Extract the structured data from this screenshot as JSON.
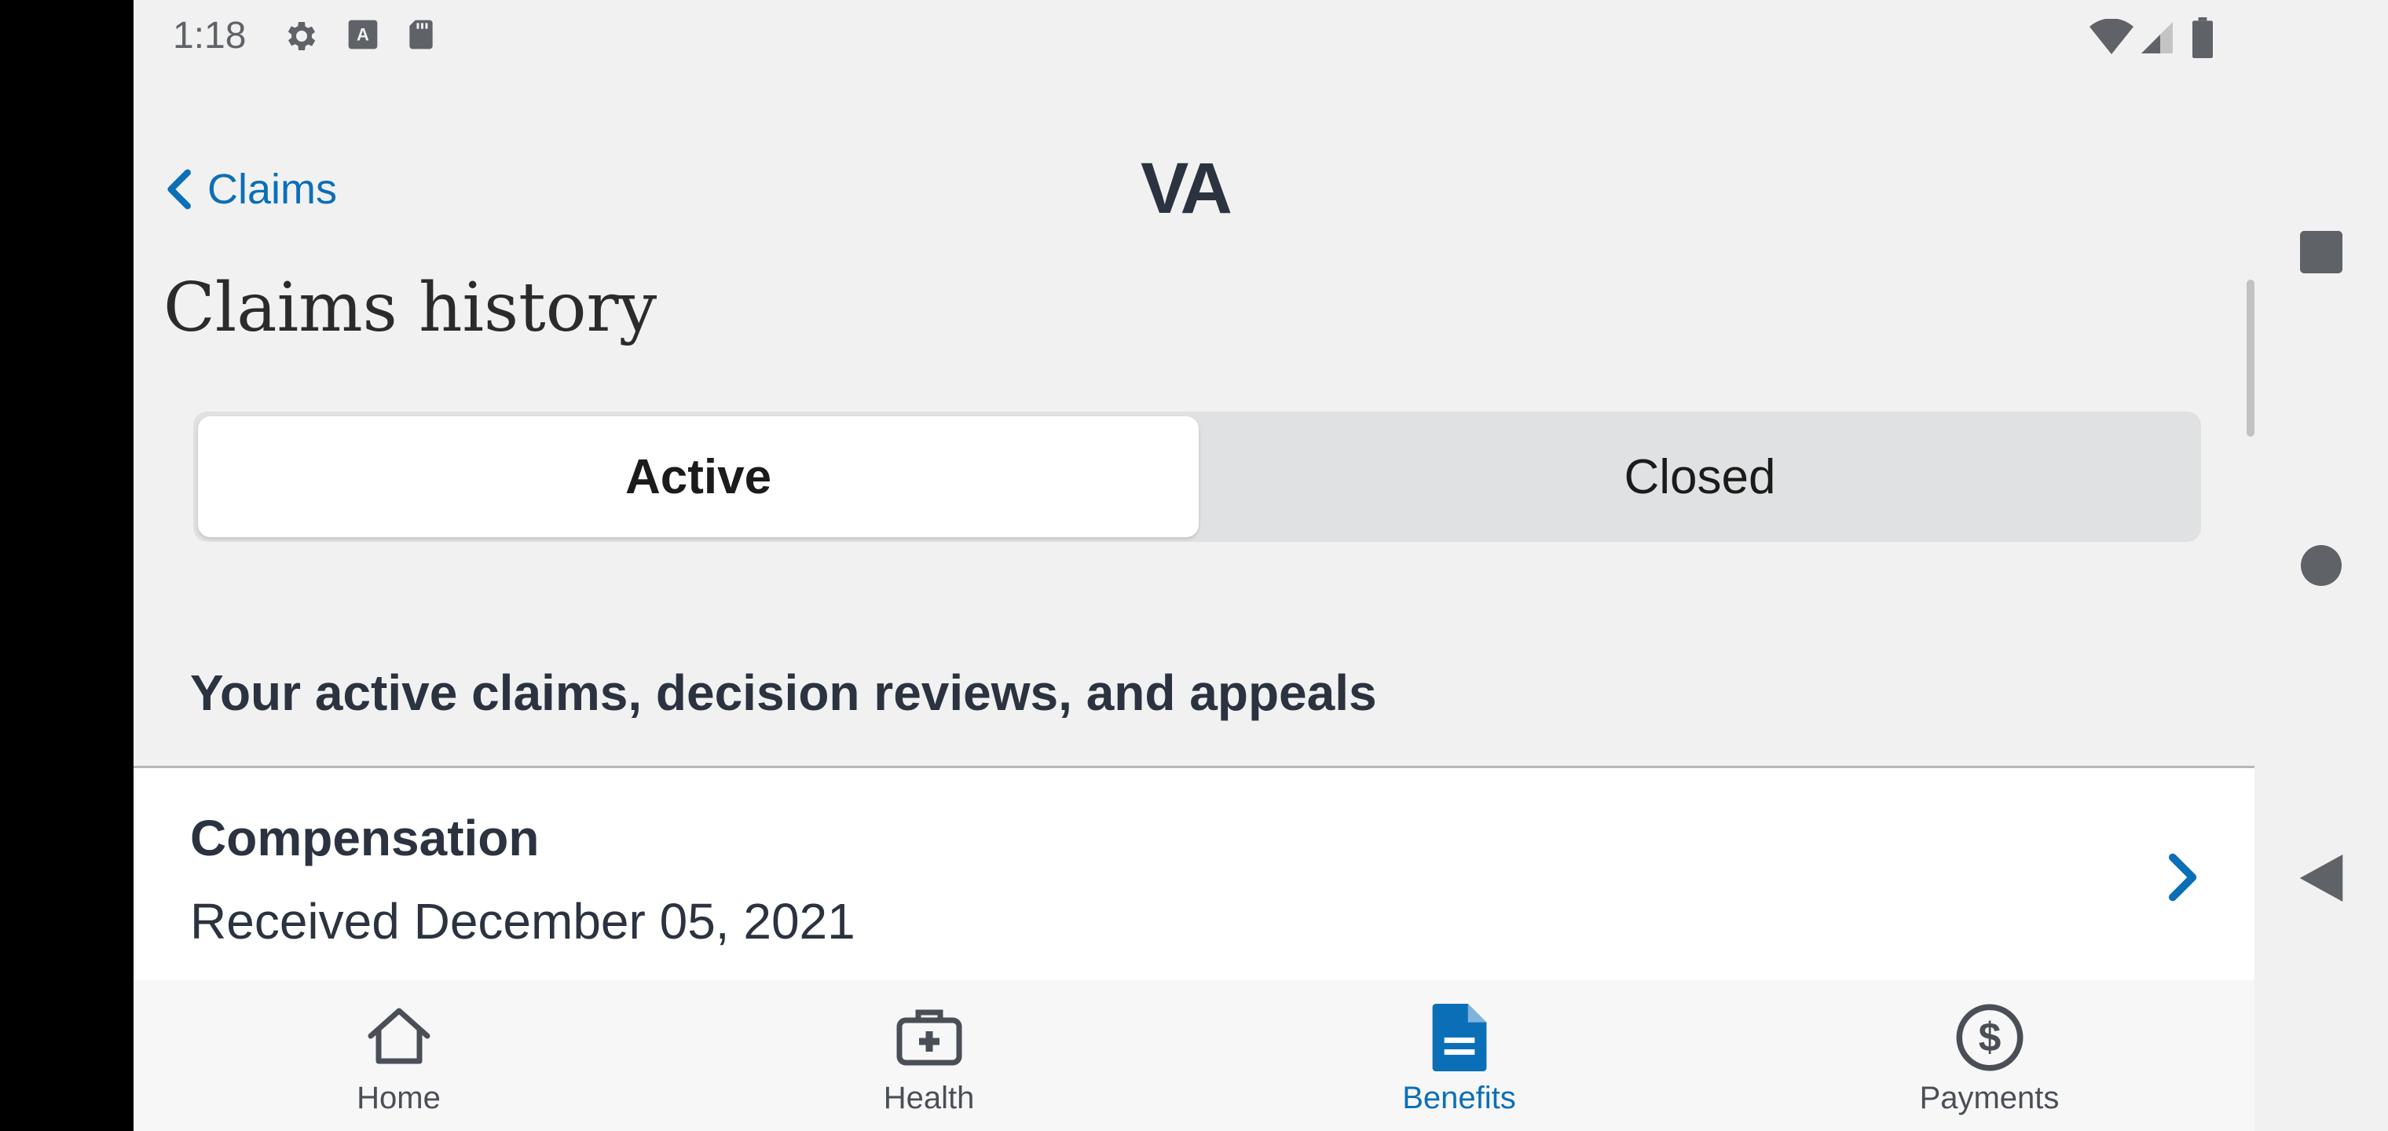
{
  "status_bar": {
    "time": "1:18"
  },
  "header": {
    "back_label": "Claims",
    "logo": "VA"
  },
  "page": {
    "title": "Claims history"
  },
  "segments": {
    "active": "Active",
    "closed": "Closed"
  },
  "section": {
    "heading": "Your active claims, decision reviews, and appeals"
  },
  "claim": {
    "title": "Compensation",
    "received": "Received December 05, 2021"
  },
  "bottom_nav": [
    {
      "label": "Home",
      "icon": "home-icon"
    },
    {
      "label": "Health",
      "icon": "medical-kit-icon"
    },
    {
      "label": "Benefits",
      "icon": "document-icon"
    },
    {
      "label": "Payments",
      "icon": "dollar-circle-icon"
    }
  ],
  "colors": {
    "accent": "#0b6fb8",
    "text": "#2b3340",
    "background": "#f1f1f1"
  }
}
